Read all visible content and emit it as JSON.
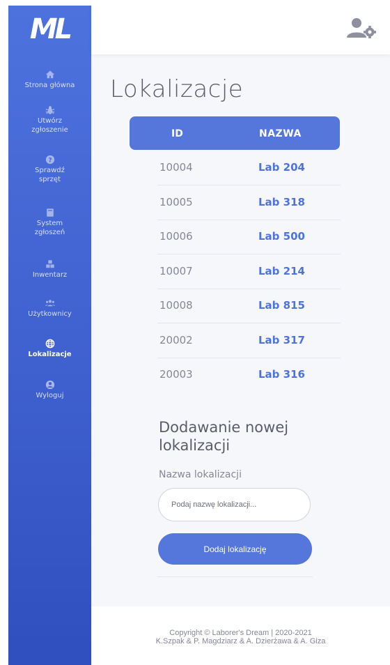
{
  "brand": {
    "logo": "ML"
  },
  "sidebar": {
    "items": [
      {
        "label": "Strona główna",
        "icon": "home-icon"
      },
      {
        "label": "Utwórz zgłoszenie",
        "icon": "bug-icon"
      },
      {
        "label": "Sprawdź sprzęt",
        "icon": "question-icon"
      },
      {
        "label": "System zgłoszeń",
        "icon": "book-icon"
      },
      {
        "label": "Inwentarz",
        "icon": "cubes-icon"
      },
      {
        "label": "Użytkownicy",
        "icon": "users-icon"
      },
      {
        "label": "Lokalizacje",
        "icon": "globe-icon",
        "active": true
      },
      {
        "label": "Wyloguj",
        "icon": "user-circle-icon"
      }
    ]
  },
  "header": {
    "icon": "user-cog-icon"
  },
  "page": {
    "title": "Lokalizacje"
  },
  "table": {
    "headers": {
      "id": "ID",
      "name": "NAZWA"
    },
    "rows": [
      {
        "id": "10004",
        "name": "Lab 204"
      },
      {
        "id": "10005",
        "name": "Lab 318"
      },
      {
        "id": "10006",
        "name": "Lab 500"
      },
      {
        "id": "10007",
        "name": "Lab 214"
      },
      {
        "id": "10008",
        "name": "Lab 815"
      },
      {
        "id": "20002",
        "name": "Lab 317"
      },
      {
        "id": "20003",
        "name": "Lab 316"
      }
    ]
  },
  "form": {
    "title": "Dodawanie nowej lokalizacji",
    "label": "Nazwa lokalizacji",
    "placeholder": "Podaj nazwę lokalizacji...",
    "value": "",
    "button": "Dodaj lokalizację"
  },
  "footer": {
    "line1": "Copyright © Laborer's Dream | 2020-2021",
    "line2": "K.Szpak & P. Magdziarz & A. Dzierżawa & A. Giza"
  },
  "colors": {
    "accent": "#4e73df",
    "sidebar_top": "#4d72de",
    "sidebar_bottom": "#2f4fbf",
    "background": "#f6f7fb",
    "text_muted": "#858796"
  }
}
